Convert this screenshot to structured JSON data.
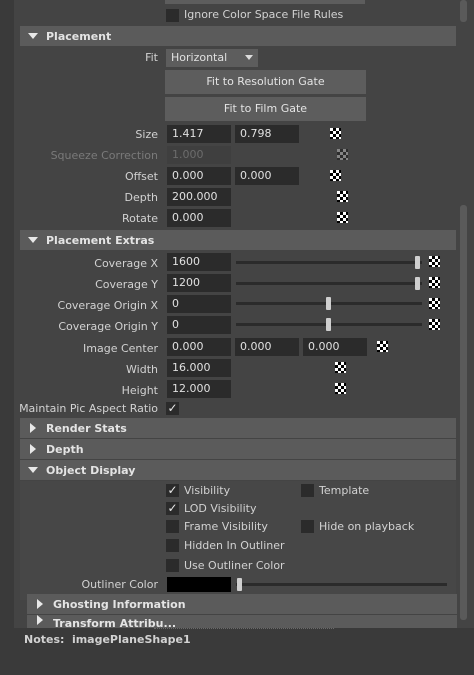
{
  "top": {
    "ignore_color_space_label": "Ignore Color Space File Rules"
  },
  "sections": {
    "placement": "Placement",
    "placement_extras": "Placement Extras",
    "render_stats": "Render Stats",
    "depth": "Depth",
    "object_display": "Object Display",
    "ghosting": "Ghosting Information",
    "partial": "Transform Attribu..."
  },
  "placement": {
    "fit_label": "Fit",
    "fit_value": "Horizontal",
    "fit_resolution_gate": "Fit to Resolution Gate",
    "fit_film_gate": "Fit to Film Gate",
    "size_label": "Size",
    "size_values": [
      "1.417",
      "0.798"
    ],
    "squeeze_label": "Squeeze Correction",
    "squeeze_value": "1.000",
    "offset_label": "Offset",
    "offset_values": [
      "0.000",
      "0.000"
    ],
    "depth_label": "Depth",
    "depth_value": "200.000",
    "rotate_label": "Rotate",
    "rotate_value": "0.000"
  },
  "placement_extras": {
    "coverage_x_label": "Coverage X",
    "coverage_x_value": "1600",
    "coverage_y_label": "Coverage Y",
    "coverage_y_value": "1200",
    "coverage_origin_x_label": "Coverage Origin X",
    "coverage_origin_x_value": "0",
    "coverage_origin_y_label": "Coverage Origin Y",
    "coverage_origin_y_value": "0",
    "image_center_label": "Image Center",
    "image_center_values": [
      "0.000",
      "0.000",
      "0.000"
    ],
    "width_label": "Width",
    "width_value": "16.000",
    "height_label": "Height",
    "height_value": "12.000",
    "maintain_aspect_label": "Maintain Pic Aspect Ratio",
    "maintain_aspect_checked": true
  },
  "object_display": {
    "visibility": "Visibility",
    "template": "Template",
    "lod_visibility": "LOD Visibility",
    "frame_visibility": "Frame Visibility",
    "hide_on_playback": "Hide on playback",
    "hidden_in_outliner": "Hidden In Outliner",
    "use_outliner_color": "Use Outliner Color",
    "outliner_color_label": "Outliner Color",
    "outliner_color_hex": "#000000"
  },
  "notes": {
    "label": "Notes:",
    "value": "imagePlaneShape1"
  },
  "icons": {
    "checker": "checker-map-icon",
    "expanded": "triangle-down-icon",
    "collapsed": "triangle-right-icon"
  }
}
